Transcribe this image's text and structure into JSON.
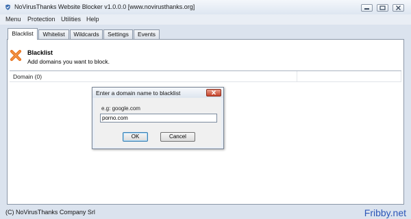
{
  "window": {
    "title": "NoVirusThanks Website Blocker v1.0.0.0 [www.novirusthanks.org]",
    "app_icon": "shield-check-icon",
    "controls": [
      "minimize-icon",
      "maximize-icon",
      "close-icon"
    ]
  },
  "menu": {
    "items": [
      "Menu",
      "Protection",
      "Utilities",
      "Help"
    ]
  },
  "tabs": [
    {
      "label": "Blacklist",
      "active": true
    },
    {
      "label": "Whitelist",
      "active": false
    },
    {
      "label": "Wildcards",
      "active": false
    },
    {
      "label": "Settings",
      "active": false
    },
    {
      "label": "Events",
      "active": false
    }
  ],
  "section": {
    "icon": "red-x-icon",
    "title": "Blacklist",
    "subtitle": "Add domains you want to block."
  },
  "list": {
    "column_header": "Domain (0)",
    "rows": []
  },
  "status": {
    "text": "(C) NoVirusThanks Company Srl"
  },
  "dialog": {
    "title": "Enter a domain name to blacklist",
    "label": "e.g: google.com",
    "input_value": "porno.com",
    "ok_label": "OK",
    "cancel_label": "Cancel"
  },
  "watermark": "Fribby.net",
  "colors": {
    "accent": "#2c56b8",
    "close_red": "#c7432b",
    "icon_orange": "#e8731f"
  }
}
